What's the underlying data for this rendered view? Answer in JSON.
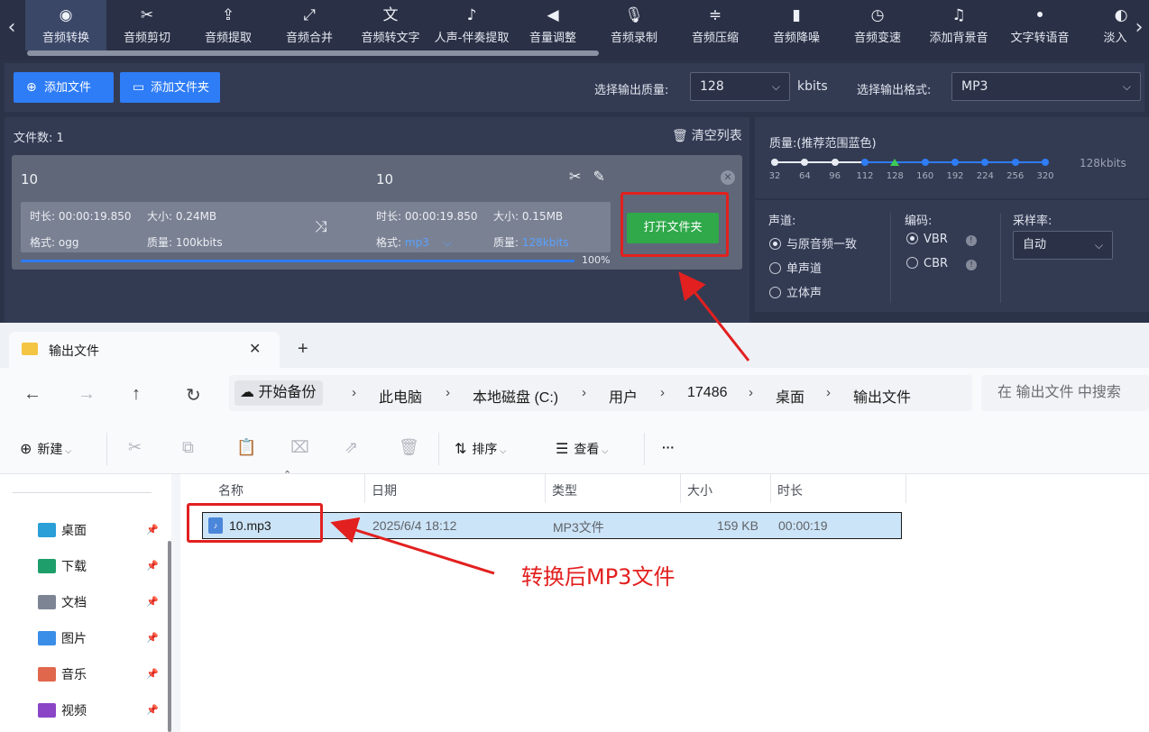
{
  "nav": {
    "items": [
      {
        "label": "音频转换",
        "icon": "audio-convert-icon",
        "glyph": "◉"
      },
      {
        "label": "音频剪切",
        "icon": "scissors-icon",
        "glyph": "✂"
      },
      {
        "label": "音频提取",
        "icon": "upload-icon",
        "glyph": "⇪"
      },
      {
        "label": "音频合并",
        "icon": "merge-icon",
        "glyph": "⤢"
      },
      {
        "label": "音频转文字",
        "icon": "audio-to-text-icon",
        "glyph": "文"
      },
      {
        "label": "人声-伴奏提取",
        "icon": "vocal-extract-icon",
        "glyph": "♪"
      },
      {
        "label": "音量调整",
        "icon": "volume-icon",
        "glyph": "◀"
      },
      {
        "label": "音频录制",
        "icon": "microphone-icon",
        "glyph": "🎙"
      },
      {
        "label": "音频压缩",
        "icon": "compress-icon",
        "glyph": "≑"
      },
      {
        "label": "音频降噪",
        "icon": "denoise-icon",
        "glyph": "▮"
      },
      {
        "label": "音频变速",
        "icon": "speed-icon",
        "glyph": "◷"
      },
      {
        "label": "添加背景音",
        "icon": "background-music-icon",
        "glyph": "♫"
      },
      {
        "label": "文字转语音",
        "icon": "text-to-speech-icon",
        "glyph": "ꔷ"
      },
      {
        "label": "淡入淡",
        "icon": "fade-icon",
        "glyph": "◐"
      }
    ],
    "active_index": 0
  },
  "toolbar": {
    "add_file": "添加文件",
    "add_folder": "添加文件夹",
    "quality_label": "选择输出质量:",
    "quality_value": "128",
    "quality_unit": "kbits",
    "format_label": "选择输出格式:",
    "format_value": "MP3"
  },
  "filelist": {
    "count_label": "文件数:",
    "count": "1",
    "clear_label": "清空列表",
    "item": {
      "source_name": "10",
      "target_name": "10",
      "src_duration": "时长: 00:00:19.850",
      "src_size": "大小: 0.24MB",
      "src_format": "格式: ogg",
      "src_quality": "质量: 100kbits",
      "dst_duration": "时长: 00:00:19.850",
      "dst_size": "大小: 0.15MB",
      "dst_format_label": "格式:",
      "dst_format_value": "mp3",
      "dst_quality_label": "质量:",
      "dst_quality_value": "128kbits",
      "progress": 1.0,
      "progress_text": "100%",
      "open_folder": "打开文件夹"
    }
  },
  "quality_panel": {
    "title": "质量:(推荐范围蓝色)",
    "ticks": [
      "32",
      "64",
      "96",
      "112",
      "128",
      "160",
      "192",
      "224",
      "256",
      "320"
    ],
    "selected": "128",
    "value_text": "128kbits",
    "colors": {
      "white": "#e8ebf2",
      "blue": "#2e7cf6",
      "selected": "#3ecb55"
    }
  },
  "options": {
    "channel_label": "声道:",
    "channels": [
      "与原音频一致",
      "单声道",
      "立体声"
    ],
    "channel_selected": 0,
    "encoding_label": "编码:",
    "encodings": [
      "VBR",
      "CBR"
    ],
    "encoding_selected": 0,
    "samplerate_label": "采样率:",
    "samplerate_value": "自动"
  },
  "explorer": {
    "tab_title": "输出文件",
    "breadcrumbs": [
      "开始备份",
      "此电脑",
      "本地磁盘 (C:)",
      "用户",
      "17486",
      "桌面",
      "输出文件"
    ],
    "search_placeholder": "在 输出文件 中搜索",
    "commands": {
      "new": "新建",
      "sort": "排序",
      "view": "查看",
      "more": "···"
    },
    "sidebar": [
      {
        "label": "桌面",
        "icon": "desktop-icon",
        "color": "#2a9fd8"
      },
      {
        "label": "下载",
        "icon": "download-icon",
        "color": "#1e9e6a"
      },
      {
        "label": "文档",
        "icon": "document-icon",
        "color": "#7d8594"
      },
      {
        "label": "图片",
        "icon": "pictures-icon",
        "color": "#3b8ee8"
      },
      {
        "label": "音乐",
        "icon": "music-icon",
        "color": "#e0674c"
      },
      {
        "label": "视频",
        "icon": "video-icon",
        "color": "#8a45c7"
      }
    ],
    "columns": [
      "名称",
      "日期",
      "类型",
      "大小",
      "时长"
    ],
    "files": [
      {
        "name": "10.mp3",
        "date": "2025/6/4 18:12",
        "type": "MP3文件",
        "size": "159 KB",
        "duration": "00:00:19"
      }
    ]
  },
  "annotation": {
    "label": "转换后MP3文件",
    "color": "#e2201f"
  }
}
